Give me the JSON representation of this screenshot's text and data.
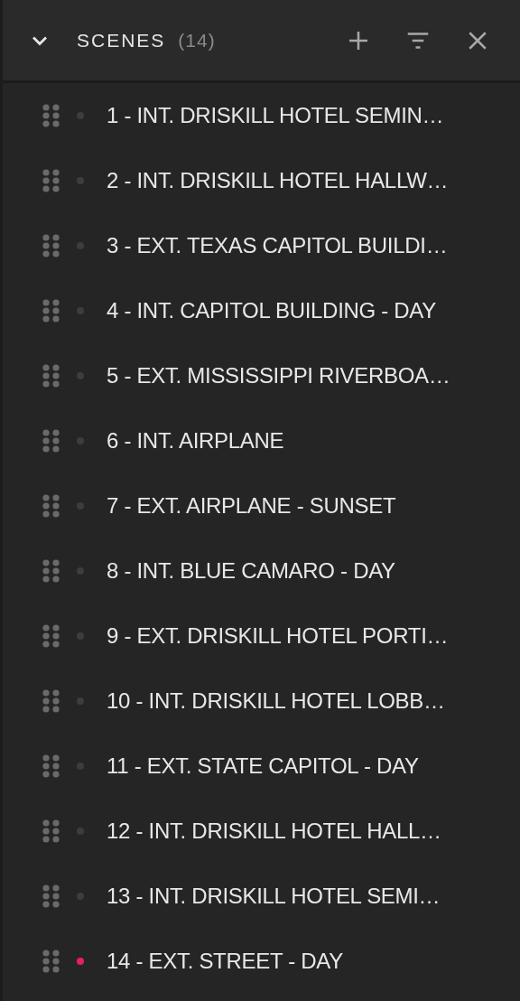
{
  "header": {
    "title": "SCENES",
    "count": "(14)",
    "expanded": true
  },
  "scenes": [
    {
      "label": "1 - INT. DRISKILL HOTEL SEMIN…",
      "color": "#3d3d3d"
    },
    {
      "label": "2 - INT. DRISKILL HOTEL HALLW…",
      "color": "#3d3d3d"
    },
    {
      "label": "3 - EXT. TEXAS CAPITOL BUILDI…",
      "color": "#3d3d3d"
    },
    {
      "label": "4 - INT. CAPITOL BUILDING - DAY",
      "color": "#3d3d3d"
    },
    {
      "label": "5 - EXT. MISSISSIPPI RIVERBOA…",
      "color": "#3d3d3d"
    },
    {
      "label": "6 - INT. AIRPLANE",
      "color": "#3d3d3d"
    },
    {
      "label": "7 - EXT. AIRPLANE - SUNSET",
      "color": "#3d3d3d"
    },
    {
      "label": "8 - INT. BLUE CAMARO - DAY",
      "color": "#3d3d3d"
    },
    {
      "label": "9 - EXT. DRISKILL HOTEL PORTI…",
      "color": "#3d3d3d"
    },
    {
      "label": "10 - INT. DRISKILL HOTEL LOBB…",
      "color": "#3d3d3d"
    },
    {
      "label": "11 - EXT. STATE CAPITOL - DAY",
      "color": "#3d3d3d"
    },
    {
      "label": "12 - INT. DRISKILL HOTEL HALL…",
      "color": "#3d3d3d"
    },
    {
      "label": "13 - INT. DRISKILL HOTEL SEMI…",
      "color": "#3d3d3d"
    },
    {
      "label": "14 - EXT. STREET - DAY",
      "color": "#e91e63"
    }
  ]
}
